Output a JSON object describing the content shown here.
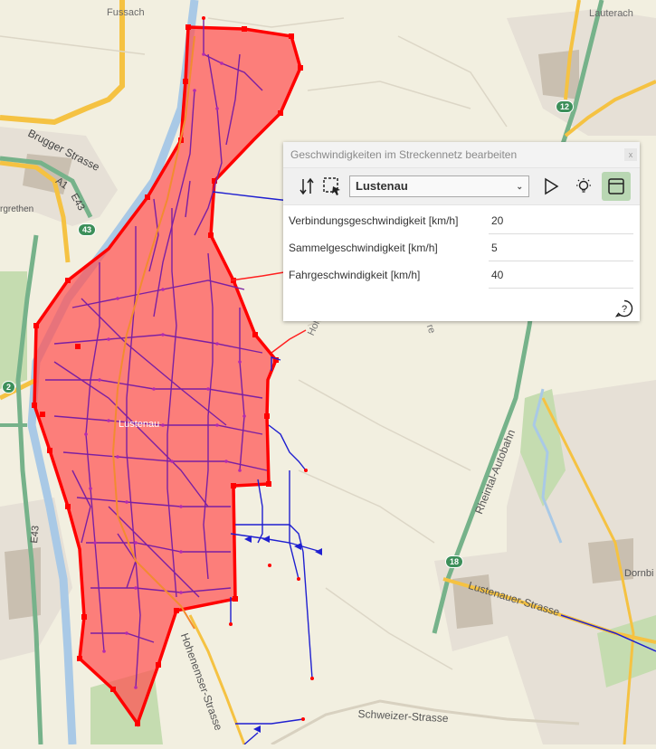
{
  "map": {
    "labels": {
      "fussach": "Fussach",
      "lauterach": "Lauterach",
      "brugger_strasse": "Brugger Strasse",
      "a1": "A1",
      "e43_top": "E43",
      "grethen": "rgrethen",
      "lustenau": "Lustenau",
      "hohenemser_1": "Hohenemser-Strasse",
      "rheintal": "Rheintal-Autobahn",
      "lustenauer_strasse": "Lustenauer-Strasse",
      "schweizer_strasse": "Schweizer-Strasse",
      "dornbirn": "Dornbi",
      "e43_left": "E43",
      "hohe_partial": "Hohe",
      "re_partial": "re"
    },
    "shields": {
      "s12": "12",
      "s43": "43",
      "s2": "2",
      "s18": "18"
    },
    "colors": {
      "polygon_fill": "#ff5252",
      "polygon_stroke": "#ff0000",
      "network": "#7b1fa2",
      "link": "#1f1fd0"
    }
  },
  "panel": {
    "title": "Geschwindigkeiten im Streckennetz bearbeiten",
    "close_label": "x",
    "selection": "Lustenau",
    "rows": [
      {
        "label": "Verbindungsgeschwindigkeit [km/h]",
        "value": "20"
      },
      {
        "label": "Sammelgeschwindigkeit [km/h]",
        "value": "5"
      },
      {
        "label": "Fahrgeschwindigkeit [km/h]",
        "value": "40"
      }
    ],
    "icons": {
      "swap": "up-down-arrows-icon",
      "select": "selection-cursor-icon",
      "play": "play-icon",
      "light": "lightbulb-icon",
      "window": "window-icon",
      "help": "help-icon"
    }
  }
}
